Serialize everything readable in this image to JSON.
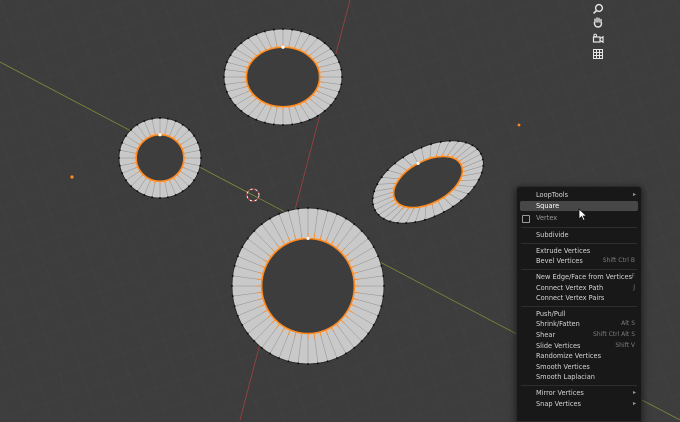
{
  "menu": {
    "items": [
      {
        "label": "LoopTools",
        "submenu": true
      },
      {
        "label": "Square",
        "active": true
      },
      {
        "label": "Vertex",
        "header": true
      },
      {
        "label": "Subdivide"
      },
      {
        "label": "Extrude Vertices"
      },
      {
        "label": "Bevel Vertices",
        "shortcut": "Shift Ctrl B"
      },
      {
        "label": "New Edge/Face from Vertices",
        "shortcut": "F"
      },
      {
        "label": "Connect Vertex Path",
        "shortcut": "J"
      },
      {
        "label": "Connect Vertex Pairs"
      },
      {
        "label": "Push/Pull"
      },
      {
        "label": "Shrink/Fatten",
        "shortcut": "Alt S"
      },
      {
        "label": "Shear",
        "shortcut": "Shift Ctrl Alt S"
      },
      {
        "label": "Slide Vertices",
        "shortcut": "Shift V"
      },
      {
        "label": "Randomize Vertices"
      },
      {
        "label": "Smooth Vertices"
      },
      {
        "label": "Smooth Laplacian"
      },
      {
        "label": "Mirror Vertices",
        "submenu": true
      },
      {
        "label": "Snap Vertices",
        "submenu": true
      }
    ]
  },
  "navigation_icons": [
    "zoom-icon",
    "hand-icon",
    "camera-icon",
    "grid-icon"
  ],
  "colors": {
    "background": "#3d3d3d",
    "mesh_fill": "#c9c9c9",
    "selected_edge": "#ff8a1f",
    "x_axis": "#b34848",
    "y_axis": "#8ea33a",
    "menu_bg": "#181818",
    "menu_highlight": "#474747"
  }
}
